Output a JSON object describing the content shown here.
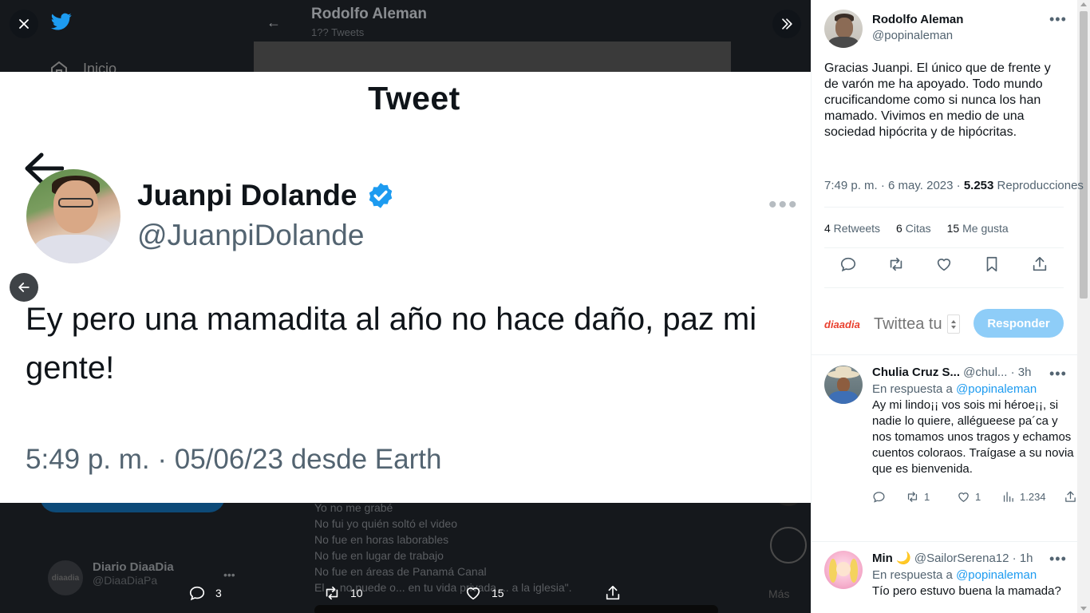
{
  "background": {
    "nav_home_label": "Inicio",
    "profile_name": "Rodolfo Aleman",
    "profile_tweet_count": "1?? Tweets",
    "text_lines": "Yo no me grabé\nNo fui yo quién soltó el video\nNo fue en horas laborables\nNo fue en lugar de trabajo\nNo fue en áreas de Panamá Canal\nEl ... no puede o... en tu vida privada ... a la iglesia\".",
    "suggest_name": "Diario DiaaDia",
    "suggest_handle": "@DiaaDiaPa",
    "suggest_logo": "diaadia",
    "more_label": "Más"
  },
  "media": {
    "header": "Tweet",
    "name": "Juanpi Dolande",
    "handle": "@JuanpiDolande",
    "text": "Ey pero una mamadita al año no hace daño, paz mi gente!",
    "timestamp": "5:49 p. m. · 05/06/23 desde Earth",
    "verified_color": "#1d9bf0"
  },
  "media_actions": {
    "replies": "3",
    "retweets": "10",
    "likes": "15"
  },
  "tweet": {
    "author_name": "Rodolfo Aleman",
    "author_handle": "@popinaleman",
    "text": "Gracias Juanpi. El único que de frente y de varón me ha apoyado. Todo mundo crucificandome como si nunca los han mamado. Vivimos en medio de una sociedad hipócrita y de hipócritas.",
    "time": "7:49 p. m. · 6 may. 2023 · ",
    "views": "5.253",
    "views_label": " Reproducciones",
    "retweets": "4",
    "retweets_label": " Retweets",
    "quotes": "6",
    "quotes_label": " Citas",
    "likes": "15",
    "likes_label": " Me gusta"
  },
  "composer": {
    "logo_a": "dia",
    "logo_b": "a",
    "logo_c": "dia",
    "placeholder": "Twittea tu respuesta",
    "button": "Responder",
    "button_color": "#8ecdf8"
  },
  "replies": [
    {
      "name": "Chulia Cruz S...",
      "handle": " @chul...",
      "time": " · 3h",
      "in_reply_label": "En respuesta a ",
      "in_reply_to": "@popinaleman",
      "text": "Ay mi lindo¡¡ vos sois mi héroe¡¡, si nadie lo quiere, allégueese pa´ca y nos tomamos unos tragos y echamos cuentos coloraos. Traígase a su novia que es bienvenida.",
      "retweets": "1",
      "likes": "1",
      "views": "1.234"
    },
    {
      "name": "Min 🌙",
      "handle": " @SailorSerena12",
      "time": " · 1h",
      "in_reply_label": "En respuesta a ",
      "in_reply_to": "@popinaleman",
      "text": "Tío pero estuvo buena la mamada?"
    }
  ],
  "icons": {
    "close": "close-icon",
    "collapse": "double-chevron-right-icon",
    "prev": "arrow-left-icon"
  }
}
